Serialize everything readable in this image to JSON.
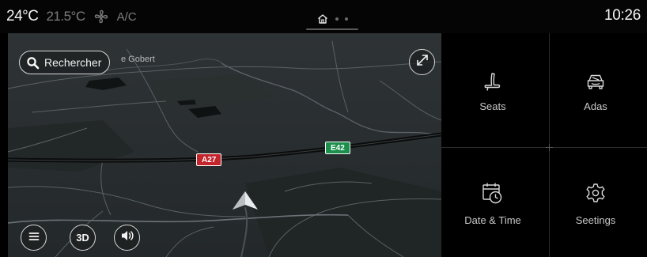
{
  "status_bar": {
    "temp_driver": "24°C",
    "temp_passenger": "21.5°C",
    "fan_icon": "fan-icon",
    "ac_label": "A/C",
    "clock": "10:26",
    "page_indicator": {
      "current": 1,
      "total": 3
    }
  },
  "map": {
    "search_label": "Rechercher",
    "street_label": "e Gobert",
    "road_shields": [
      {
        "label": "A27",
        "color": "#c4252c"
      },
      {
        "label": "E42",
        "color": "#1b8f4b"
      }
    ],
    "buttons": {
      "menu": "menu-icon",
      "view_mode": "3D",
      "sound": "volume-icon",
      "expand": "expand-icon"
    }
  },
  "tiles": [
    {
      "label": "Seats",
      "icon": "seat-icon"
    },
    {
      "label": "Adas",
      "icon": "car-front-icon"
    },
    {
      "label": "Date & Time",
      "icon": "calendar-clock-icon"
    },
    {
      "label": "Seetings",
      "icon": "gear-icon"
    }
  ],
  "colors": {
    "background": "#000000",
    "map_land": "#252a2b",
    "road_shield_a": "#c4252c",
    "road_shield_e": "#1b8f4b"
  }
}
